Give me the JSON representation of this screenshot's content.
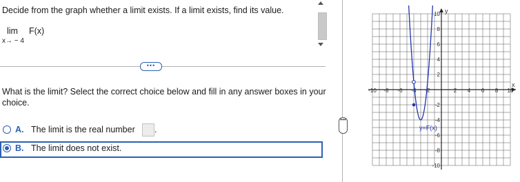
{
  "question": {
    "instruction": "Decide from the graph whether a limit exists. If a limit exists, find its value.",
    "lim_word": "lim",
    "lim_function": "F(x)",
    "lim_subscript": "x→ − 4"
  },
  "expand_label": "•••",
  "prompt": "What is the limit? Select the correct choice below and fill in any answer boxes in your choice.",
  "choices": [
    {
      "letter": "A.",
      "text": "The limit is the real number",
      "selected": false,
      "answer_value": "",
      "trailing": "."
    },
    {
      "letter": "B.",
      "text": "The limit does not exist.",
      "selected": true
    }
  ],
  "vertical_expand_label": "•••",
  "graph": {
    "x_label": "x",
    "y_label": "y",
    "function_label": "y=F(x)",
    "x_ticks": [
      "-10",
      "-8",
      "-6",
      "-4",
      "-2",
      "2",
      "4",
      "6",
      "8",
      "10"
    ],
    "y_ticks": [
      "10",
      "8",
      "6",
      "4",
      "2",
      "-2",
      "-4",
      "-6",
      "-8",
      "-10"
    ],
    "xlim": [
      -10,
      10
    ],
    "ylim": [
      -10,
      10
    ],
    "curve_color": "#2233aa",
    "open_point": [
      -4,
      1
    ],
    "closed_point": [
      -4,
      -2
    ]
  }
}
